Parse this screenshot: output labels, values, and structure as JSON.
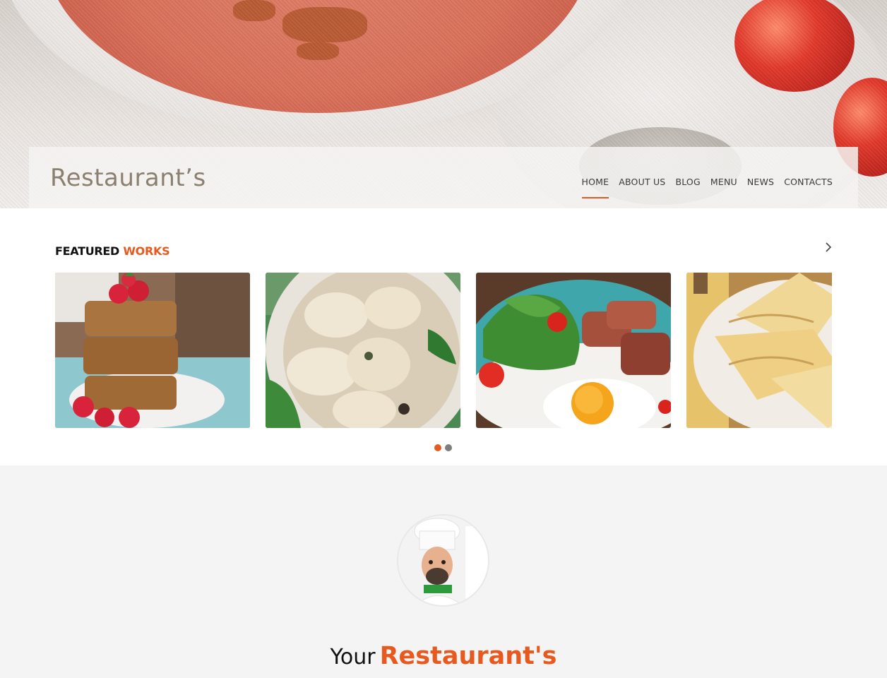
{
  "header": {
    "logo": "Restaurant’s",
    "nav": [
      {
        "label": "HOME",
        "active": true
      },
      {
        "label": "ABOUT US",
        "active": false
      },
      {
        "label": "BLOG",
        "active": false
      },
      {
        "label": "MENU",
        "active": false
      },
      {
        "label": "NEWS",
        "active": false
      },
      {
        "label": "CONTACTS",
        "active": false
      }
    ]
  },
  "featured": {
    "title_part1": "FEATURED",
    "title_part2": "WORKS",
    "next_icon": "chevron-right-icon",
    "items": [
      {
        "name": "oat-bars-with-raspberries"
      },
      {
        "name": "dumplings-bowl"
      },
      {
        "name": "beef-with-fried-egg-salad"
      },
      {
        "name": "crepes"
      }
    ],
    "dots_total": 2,
    "dots_active": 0
  },
  "chef": {
    "avatar": "chef-portrait",
    "headline_part1": "Your",
    "headline_part2": "Restaurant's"
  },
  "colors": {
    "accent": "#e75a1f",
    "text_dark": "#111111",
    "logo": "#8b7f70",
    "section_bg": "#f4f4f4"
  }
}
